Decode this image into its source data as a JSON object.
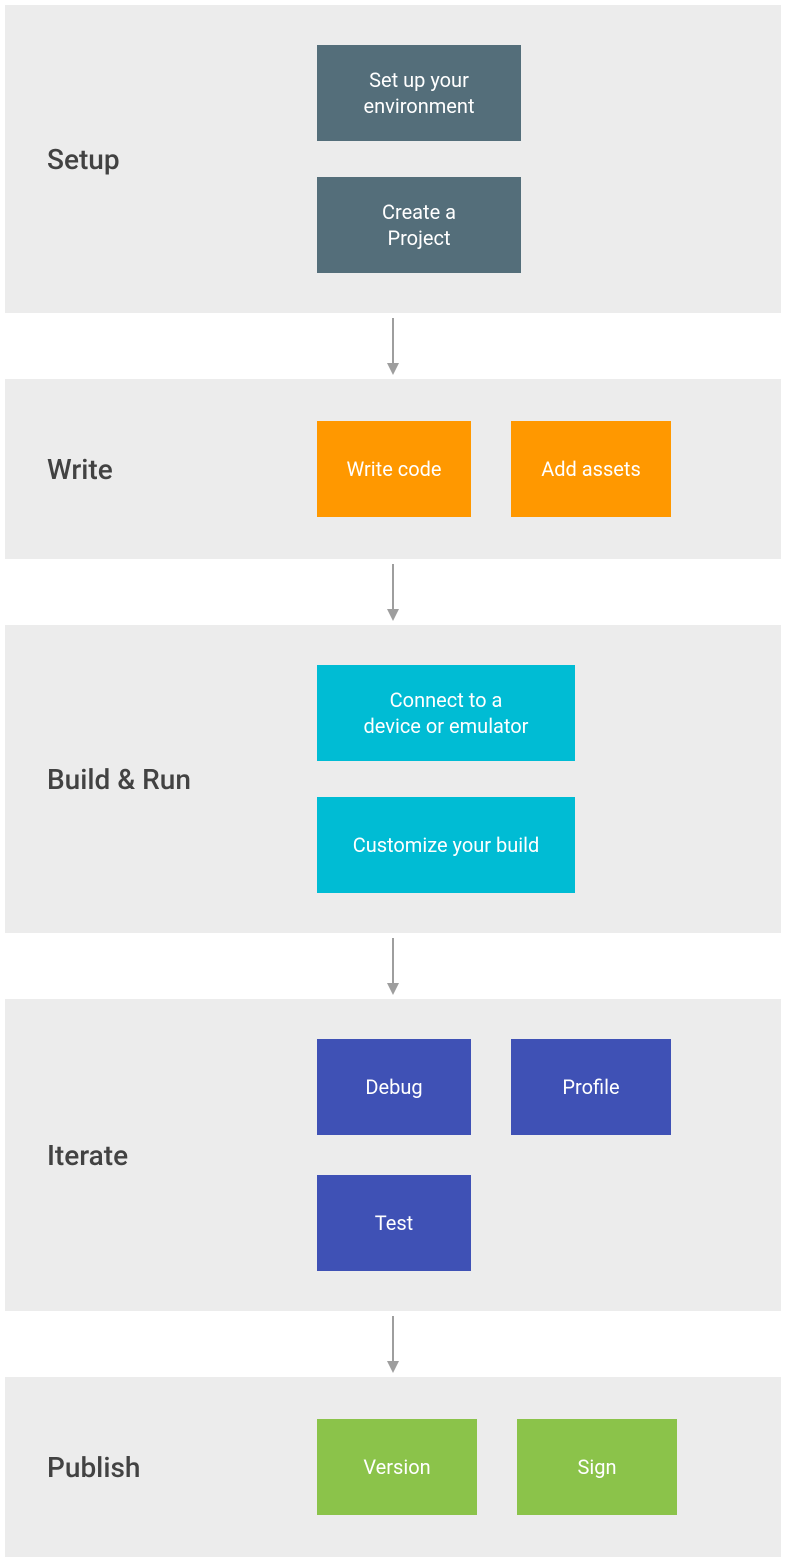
{
  "stages": [
    {
      "label": "Setup",
      "colorClass": "color-setup",
      "layout": "vertical",
      "cards": [
        {
          "text": "Set up your\nenvironment",
          "widthClass": "w204"
        },
        {
          "text": "Create a\nProject",
          "widthClass": "w204"
        }
      ]
    },
    {
      "label": "Write",
      "colorClass": "color-write",
      "layout": "horizontal",
      "cards": [
        {
          "text": "Write code",
          "widthClass": "w154"
        },
        {
          "text": "Add assets",
          "widthClass": "w160"
        }
      ]
    },
    {
      "label": "Build & Run",
      "colorClass": "color-build",
      "layout": "vertical",
      "cards": [
        {
          "text": "Connect to a\ndevice or emulator",
          "widthClass": "w258"
        },
        {
          "text": "Customize your build",
          "widthClass": "w258"
        }
      ]
    },
    {
      "label": "Iterate",
      "colorClass": "color-iterate",
      "layout": "horizontal-wrap",
      "cards": [
        {
          "text": "Debug",
          "widthClass": "w154"
        },
        {
          "text": "Profile",
          "widthClass": "w160"
        },
        {
          "text": "Test",
          "widthClass": "w154"
        }
      ]
    },
    {
      "label": "Publish",
      "colorClass": "color-publish",
      "layout": "horizontal",
      "cards": [
        {
          "text": "Version",
          "widthClass": "w160"
        },
        {
          "text": "Sign",
          "widthClass": "w160"
        }
      ]
    }
  ]
}
